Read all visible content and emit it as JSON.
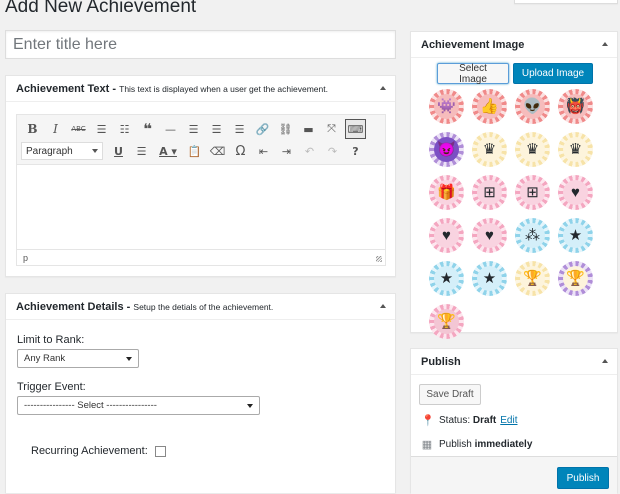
{
  "page": {
    "title": "Add New Achievement",
    "title_placeholder": "Enter title here"
  },
  "achievement_text": {
    "title": "Achievement Text",
    "description": "This text is displayed when a user get the achievement.",
    "format_select": "Paragraph",
    "status_path": "p",
    "toolbar_row1": [
      "bold-icon",
      "italic-icon",
      "strikethrough-icon",
      "bullet-list-icon",
      "numbered-list-icon",
      "blockquote-icon",
      "horizontal-rule-icon",
      "align-left-icon",
      "align-center-icon",
      "align-right-icon",
      "link-icon",
      "unlink-icon",
      "read-more-icon",
      "fullscreen-icon",
      "toolbar-toggle-icon"
    ],
    "toolbar_row2": [
      "underline-icon",
      "justify-icon",
      "text-color-icon",
      "paste-as-text-icon",
      "clear-formatting-icon",
      "special-character-icon",
      "outdent-icon",
      "indent-icon",
      "undo-icon",
      "redo-icon",
      "help-icon"
    ]
  },
  "achievement_details": {
    "title": "Achievement Details",
    "description": "Setup the detials of the achievement.",
    "limit_label": "Limit to Rank:",
    "limit_value": "Any Rank",
    "trigger_label": "Trigger Event:",
    "trigger_value": "---------------- Select ----------------",
    "recurring_label": "Recurring Achievement:",
    "recurring_checked": false
  },
  "achievement_image": {
    "title": "Achievement Image",
    "select_label": "Select Image",
    "upload_label": "Upload Image",
    "badges": [
      {
        "name": "badge-green-monster",
        "ring": "ring-red",
        "inner": "in-salmon",
        "glyph": "👾"
      },
      {
        "name": "badge-thumbs-up",
        "ring": "ring-red",
        "inner": "in-salmon",
        "glyph": "👍"
      },
      {
        "name": "badge-one-eyed-monster",
        "ring": "ring-red",
        "inner": "in-salmon",
        "glyph": "👽"
      },
      {
        "name": "badge-teal-monster",
        "ring": "ring-red",
        "inner": "in-salmon",
        "glyph": "👹"
      },
      {
        "name": "badge-purple-monster",
        "ring": "ring-purple",
        "inner": "in-purple",
        "glyph": "😈"
      },
      {
        "name": "badge-crown-1",
        "ring": "ring-yellow",
        "inner": "in-cream",
        "glyph": "♛"
      },
      {
        "name": "badge-crown-2",
        "ring": "ring-yellow",
        "inner": "in-cream",
        "glyph": "♛"
      },
      {
        "name": "badge-crown-3",
        "ring": "ring-yellow",
        "inner": "in-cream",
        "glyph": "♛"
      },
      {
        "name": "badge-gift-box",
        "ring": "ring-pink",
        "inner": "in-pink",
        "glyph": "🎁"
      },
      {
        "name": "badge-gift-plus",
        "ring": "ring-pink",
        "inner": "in-pink",
        "glyph": "⊞"
      },
      {
        "name": "badge-gift-plus-2",
        "ring": "ring-pink",
        "inner": "in-pink",
        "glyph": "⊞"
      },
      {
        "name": "badge-heart-minus",
        "ring": "ring-pink",
        "inner": "in-pink",
        "glyph": "♥"
      },
      {
        "name": "badge-heart-plus",
        "ring": "ring-pink",
        "inner": "in-pink",
        "glyph": "♥"
      },
      {
        "name": "badge-heart",
        "ring": "ring-pink",
        "inner": "in-pink",
        "glyph": "♥"
      },
      {
        "name": "badge-stars",
        "ring": "ring-blue",
        "inner": "in-blue",
        "glyph": "⁂"
      },
      {
        "name": "badge-star-bowl",
        "ring": "ring-blue",
        "inner": "in-blue",
        "glyph": "★"
      },
      {
        "name": "badge-star-1",
        "ring": "ring-blue",
        "inner": "in-blue",
        "glyph": "★"
      },
      {
        "name": "badge-star-2",
        "ring": "ring-blue",
        "inner": "in-blue",
        "glyph": "★"
      },
      {
        "name": "badge-trophy-gold",
        "ring": "ring-yellow",
        "inner": "in-cream",
        "glyph": "🏆"
      },
      {
        "name": "badge-trophy-purple",
        "ring": "ring-purple",
        "inner": "in-cream",
        "glyph": "🏆"
      },
      {
        "name": "badge-trophy-pink",
        "ring": "ring-pink",
        "inner": "in-gold",
        "glyph": "🏆"
      }
    ]
  },
  "publish": {
    "title": "Publish",
    "save_draft_label": "Save Draft",
    "status_label": "Status:",
    "status_value": "Draft",
    "status_edit_label": "Edit",
    "publish_label": "Publish",
    "publish_value": "immediately",
    "publish_button_label": "Publish"
  },
  "colors": {
    "primary_button": "#0085ba",
    "link": "#0073aa",
    "background": "#f1f1f1"
  }
}
